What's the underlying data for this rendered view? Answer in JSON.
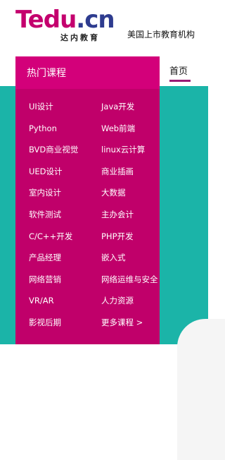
{
  "header": {
    "logo_main_1": "Tedu",
    "logo_main_2": ".cn",
    "logo_sub": "达内教育",
    "tagline": "美国上市教育机构"
  },
  "nav": {
    "home": "首页"
  },
  "menu": {
    "title": "热门课程",
    "left": [
      "UI设计",
      "Python",
      "BVD商业视觉",
      "UED设计",
      "室内设计",
      "软件测试",
      "C/C++开发",
      "产品经理",
      "网络营销",
      "VR/AR",
      "影视后期"
    ],
    "right": [
      "Java开发",
      "Web前端",
      "linux云计算",
      "商业插画",
      "大数据",
      "主办会计",
      "PHP开发",
      "嵌入式",
      "网络运维与安全",
      "人力资源",
      "更多课程 >"
    ]
  }
}
